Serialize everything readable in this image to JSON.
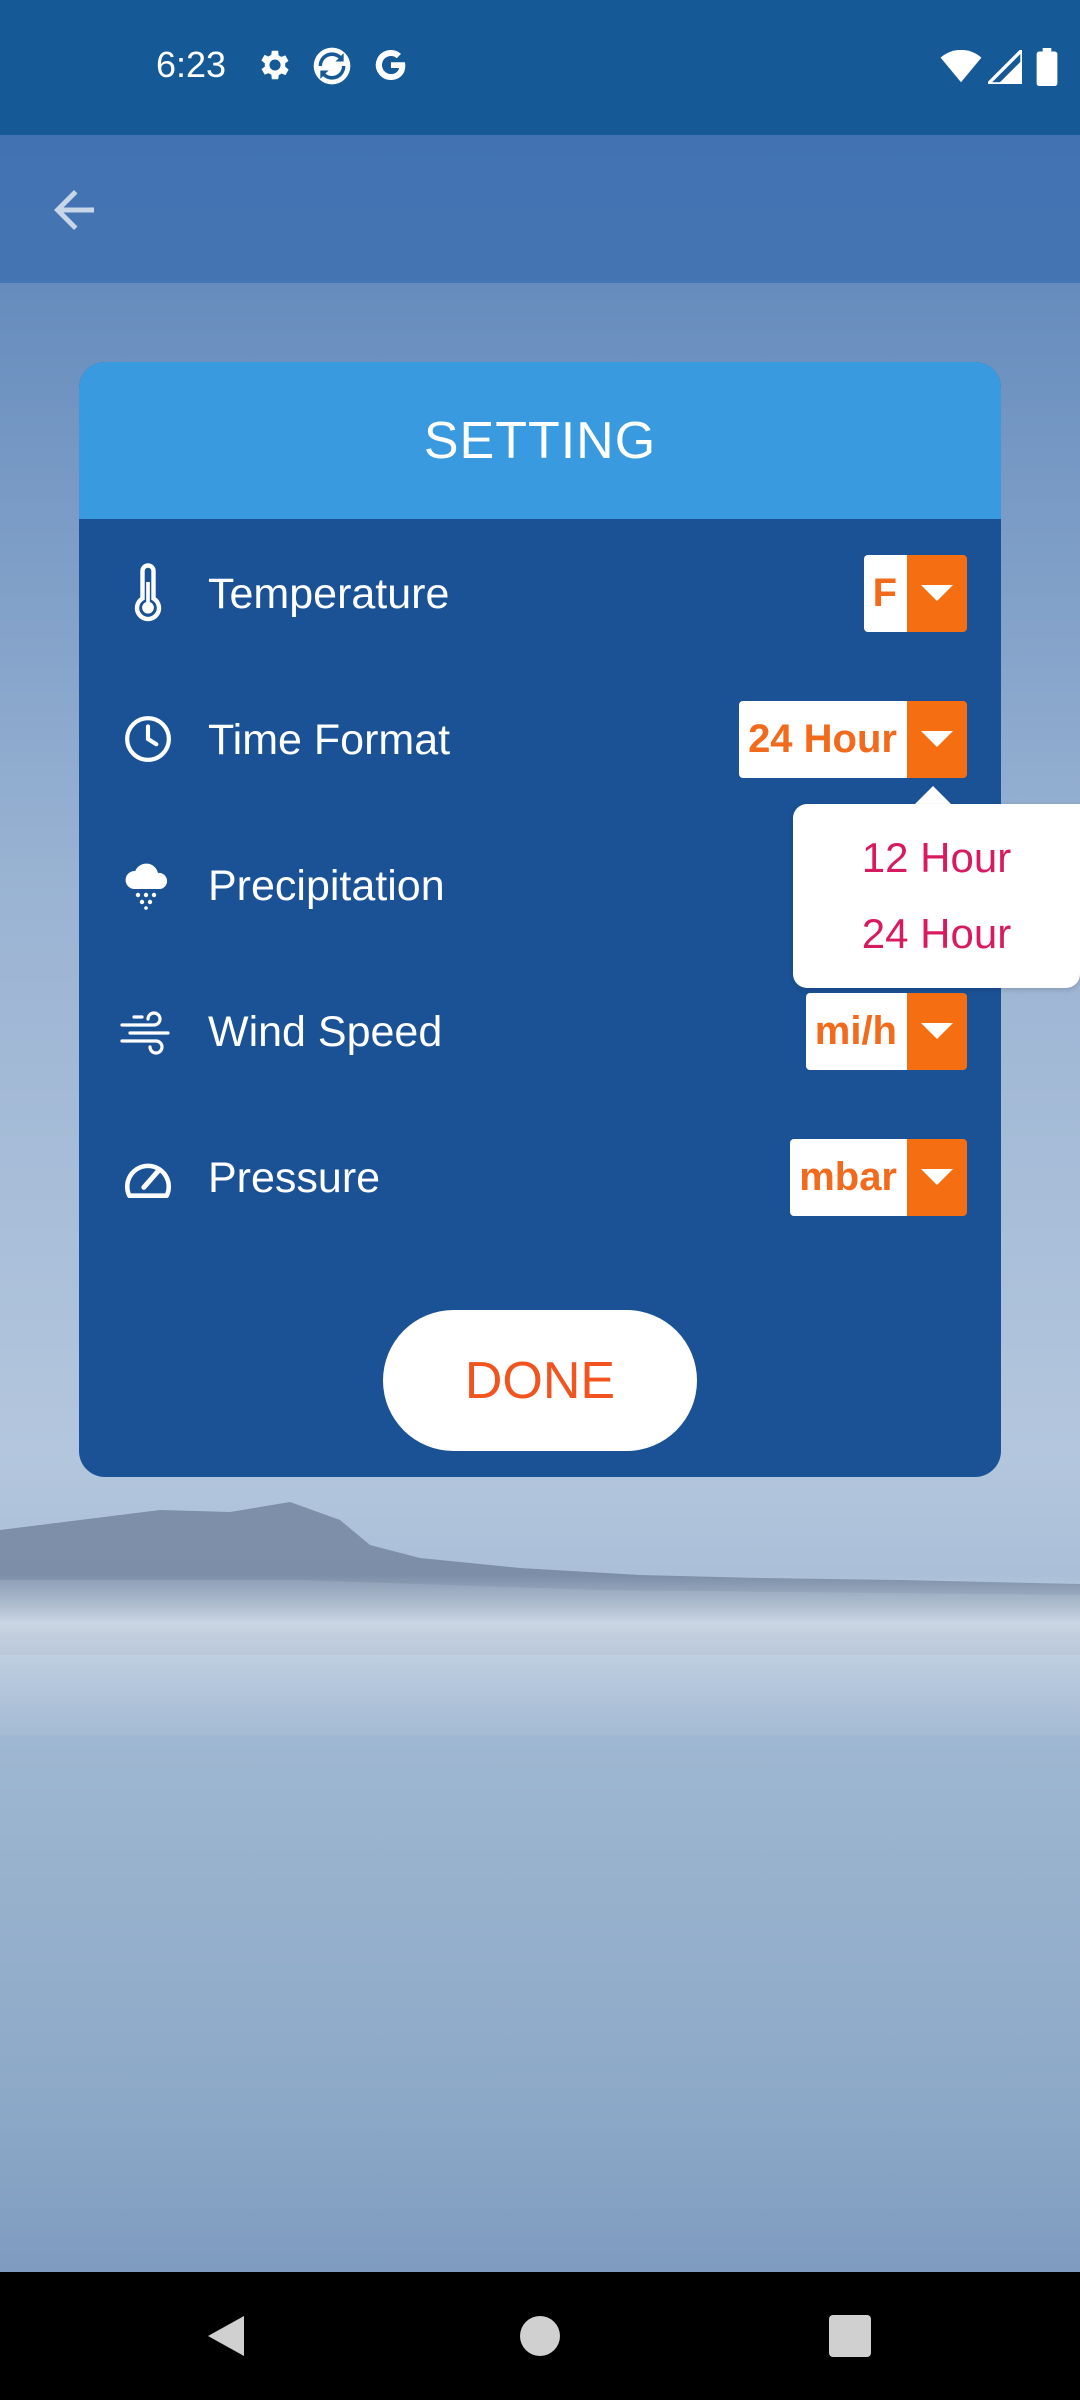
{
  "status_bar": {
    "time": "6:23",
    "left_icons": [
      "settings-gear-icon",
      "sync-app-icon",
      "google-g-icon"
    ],
    "right_icons": [
      "wifi-icon",
      "cell-signal-icon",
      "battery-icon"
    ]
  },
  "toolbar": {
    "back_icon": "arrow-left-icon"
  },
  "dialog": {
    "title": "SETTING",
    "header_color": "#3a9ae0",
    "body_color": "#1b5296",
    "rows": [
      {
        "label": "Temperature",
        "icon": "thermometer-icon",
        "value": "F"
      },
      {
        "label": "Time Format",
        "icon": "clock-icon",
        "value": "24 Hour"
      },
      {
        "label": "Precipitation",
        "icon": "rain-cloud-icon",
        "value": ""
      },
      {
        "label": "Wind Speed",
        "icon": "wind-icon",
        "value": "mi/h"
      },
      {
        "label": "Pressure",
        "icon": "gauge-icon",
        "value": "mbar"
      }
    ],
    "done_label": "DONE"
  },
  "popup_menu": {
    "items": [
      "12 Hour",
      "24 Hour"
    ],
    "text_color": "#d81b60"
  },
  "accent_color": "#f56e12",
  "nav_bar": {
    "buttons": [
      "back-triangle-icon",
      "home-circle-icon",
      "recents-square-icon"
    ]
  }
}
